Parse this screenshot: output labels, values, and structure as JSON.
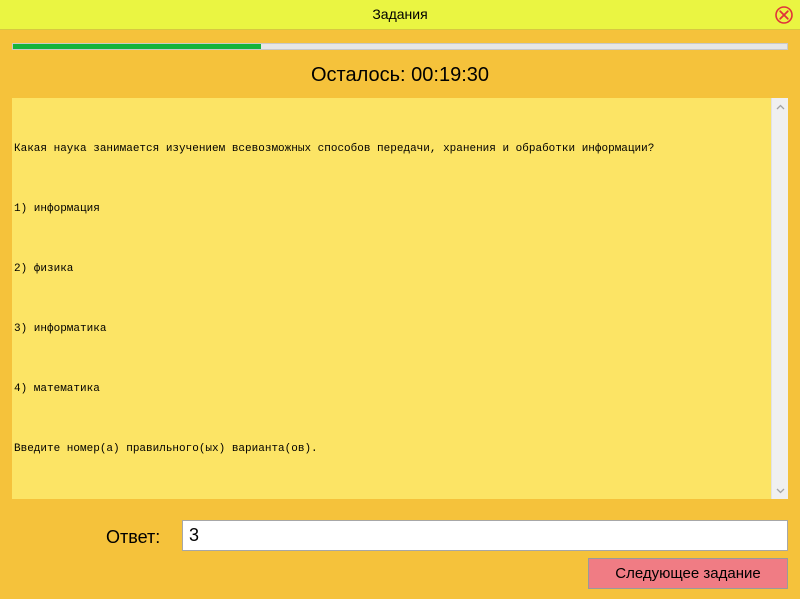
{
  "window": {
    "title": "Задания"
  },
  "progress": {
    "fraction": 0.32
  },
  "timer": {
    "text": "Осталось: 00:19:30"
  },
  "question": {
    "prompt": "Какая наука занимается изучением всевозможных способов передачи, хранения и обработки информации?",
    "options": [
      "1) информация",
      "2) физика",
      "3) информатика",
      "4) математика"
    ],
    "instruction": "Введите номер(а) правильного(ых) варианта(ов)."
  },
  "answer": {
    "label": "Ответ:",
    "value": "3"
  },
  "buttons": {
    "next_label": "Следующее задание"
  },
  "colors": {
    "window_bg": "#f5c23b",
    "titlebar_bg": "#eaf542",
    "question_bg": "#fce465",
    "progress_fill": "#14b33c",
    "next_button_bg": "#f07c84",
    "close_icon": "#e0333a"
  },
  "icons": {
    "close": "close-circle-x-icon",
    "scroll_up": "chevron-up-icon",
    "scroll_down": "chevron-down-icon"
  }
}
